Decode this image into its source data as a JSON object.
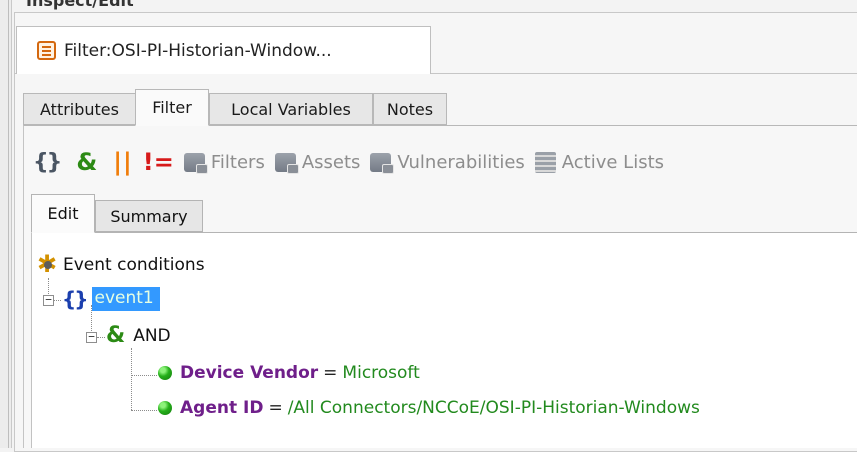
{
  "panel_title": "Inspect/Edit",
  "document_tab": {
    "label": "Filter:OSI-PI-Historian-Window..."
  },
  "tabs": [
    {
      "label": "Attributes",
      "active": false
    },
    {
      "label": "Filter",
      "active": true
    },
    {
      "label": "Local Variables",
      "active": false
    },
    {
      "label": "Notes",
      "active": false
    }
  ],
  "toolbar": {
    "curly": "{}",
    "and": "&",
    "or": "||",
    "not_equal": "!=",
    "filters_label": "Filters",
    "assets_label": "Assets",
    "vulnerabilities_label": "Vulnerabilities",
    "active_lists_label": "Active Lists"
  },
  "subtabs": [
    {
      "label": "Edit",
      "active": true
    },
    {
      "label": "Summary",
      "active": false
    }
  ],
  "tree": {
    "root_label": "Event conditions",
    "event_label": "event1",
    "event_curly": "{}",
    "and_glyph": "&",
    "and_label": "AND",
    "conditions": [
      {
        "field": "Device Vendor",
        "operator": "=",
        "value": "Microsoft"
      },
      {
        "field": "Agent ID",
        "operator": "=",
        "value": "/All Connectors/NCCoE/OSI-PI-Historian-Windows"
      }
    ]
  },
  "colors": {
    "selection": "#3399ff",
    "field_purple": "#6f1f8a",
    "value_green": "#228a1e",
    "and_green": "#2b8a14",
    "or_orange": "#f07d0a",
    "neq_red": "#d71a1a"
  }
}
